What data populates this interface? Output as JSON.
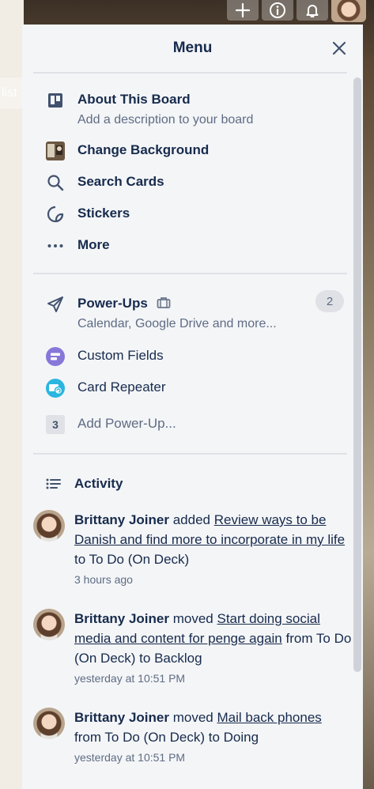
{
  "background": {
    "list_tab_label": "list"
  },
  "header_buttons": {
    "add_icon": "plus-icon",
    "info_icon": "info-icon",
    "notifications_icon": "bell-icon"
  },
  "menu": {
    "title": "Menu",
    "main_items": [
      {
        "label": "About This Board",
        "sub": "Add a description to your board",
        "icon": "board-icon"
      },
      {
        "label": "Change Background",
        "icon": "background-thumbnail"
      },
      {
        "label": "Search Cards",
        "icon": "search-icon"
      },
      {
        "label": "Stickers",
        "icon": "sticker-icon"
      },
      {
        "label": "More",
        "icon": "more-icon"
      }
    ],
    "powerups": {
      "label": "Power-Ups",
      "sub": "Calendar, Google Drive and more...",
      "count": "2",
      "items": [
        {
          "label": "Custom Fields",
          "icon": "custom-fields-icon",
          "color": "#8777d9"
        },
        {
          "label": "Card Repeater",
          "icon": "card-repeater-icon",
          "color": "#29b6e0"
        }
      ],
      "add": {
        "chip": "3",
        "label": "Add Power-Up..."
      }
    },
    "activity": {
      "label": "Activity",
      "entries": [
        {
          "user": "Brittany Joiner",
          "action": "added",
          "card": "Review ways to be Danish and find more to incorporate in my life",
          "rest": "to To Do (On Deck)",
          "time": "3 hours ago"
        },
        {
          "user": "Brittany Joiner",
          "action": "moved",
          "card": "Start doing social media and content for penge again",
          "rest": "from To Do (On Deck) to Backlog",
          "time": "yesterday at 10:51 PM"
        },
        {
          "user": "Brittany Joiner",
          "action": "moved",
          "card": "Mail back phones",
          "rest": "from To Do (On Deck) to Doing",
          "time": "yesterday at 10:51 PM"
        }
      ]
    }
  },
  "colors": {
    "text_primary": "#172b4d",
    "text_muted": "#5e6c84",
    "panel_bg": "#f4f5f7",
    "divider": "#dfe1e6"
  }
}
